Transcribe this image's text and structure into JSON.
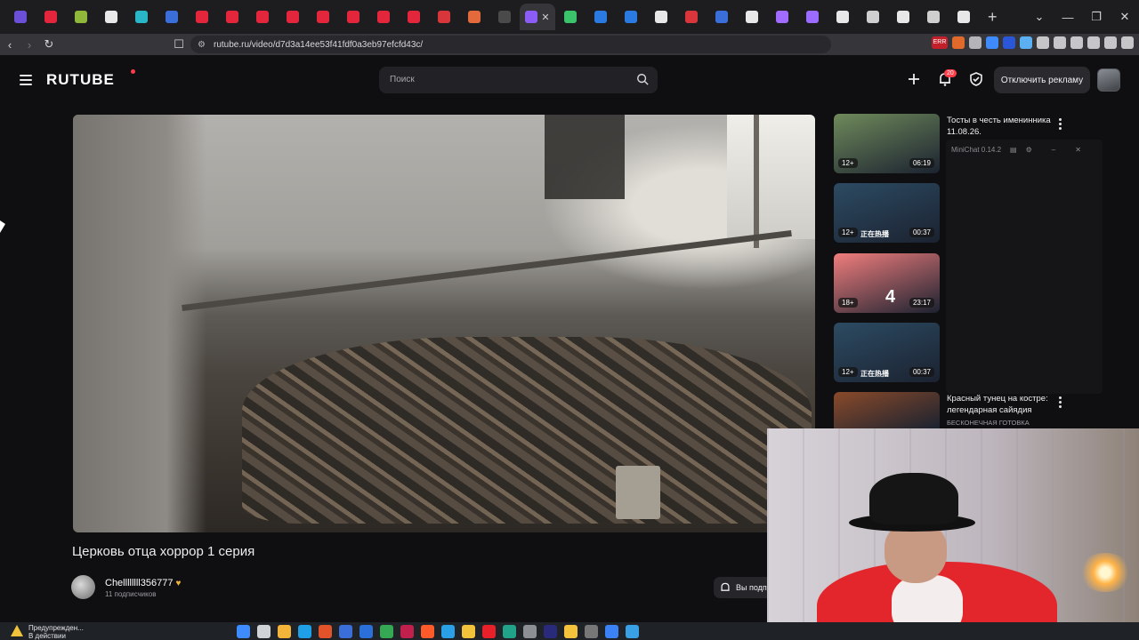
{
  "browser": {
    "tab_count": 34,
    "active_tab_close": "✕",
    "new_tab": "+",
    "window_controls": [
      "⌄",
      "—",
      "❐",
      "✕"
    ],
    "url": "rutube.ru/video/d7d3a14ee53f41fdf0a3eb97efcfd43c/",
    "tab_colors": [
      "#6b4fd8",
      "#e3263b",
      "#8fb83b",
      "#e8e8e8",
      "#29b6c8",
      "#3a6ed8",
      "#e3263b",
      "#e3263b",
      "#e3263b",
      "#e3263b",
      "#e3263b",
      "#e3263b",
      "#e3263b",
      "#e3263b",
      "#d8363b",
      "#e56a3b",
      "#4a4a4a",
      "#8b5cf6",
      "#3ac36a",
      "#2a7ae2",
      "#2a7ae2",
      "#e8e8e8",
      "#d8363b",
      "#3a6ed8",
      "#e8e8e8",
      "#a16bff",
      "#9b6bff",
      "#e8e8e8",
      "#cfcfcf",
      "#e8e8e8",
      "#cfcfcf",
      "#e8e8e8"
    ],
    "ext_badge": "ERR"
  },
  "header": {
    "logo": "RUTUBE",
    "search_placeholder": "Поиск",
    "notifications_count": "20",
    "ads_button": "Отключить рекламу"
  },
  "video": {
    "title": "Церковь отца хоррор 1 серия",
    "channel": "Chellllllll356777",
    "subscribers": "11 подписчиков",
    "subscribe_label": "Вы подп"
  },
  "recommendations": [
    {
      "title": "Тосты в честь именинника 11.08.26.",
      "channel": "",
      "age": "12+",
      "duration": "06:19",
      "color": "#6f8a5b"
    },
    {
      "title": "",
      "channel": "",
      "age": "12+",
      "duration": "00:37",
      "color": "#2c4b62",
      "overlay": "正在热播"
    },
    {
      "title": "",
      "channel": "",
      "age": "18+",
      "duration": "23:17",
      "color": "#f07d7d",
      "overlay": "4"
    },
    {
      "title": "",
      "channel": "",
      "age": "12+",
      "duration": "00:37",
      "color": "#2c4b62",
      "overlay": "正在热播"
    },
    {
      "title": "Красный тунец на костре: легендарная сайядия",
      "channel": "БЕСКОНЕЧНАЯ ГОТОВКА",
      "age": "",
      "duration": "",
      "color": "#8a4a2a"
    }
  ],
  "minichat": {
    "title": "MiniChat 0.14.2"
  },
  "taskbar": {
    "warning_line1": "Предупрежден...",
    "warning_line2": "В действии",
    "icon_colors": [
      "#3d8bfd",
      "#cfd3d8",
      "#f2b53a",
      "#1fa0e6",
      "#e2532a",
      "#3a6ed8",
      "#2b6fd8",
      "#34a853",
      "#c0204b",
      "#ff5a2a",
      "#2aa1e6",
      "#f2c23a",
      "#e8202a",
      "#21a38a",
      "#8c8f93",
      "#2a2a7a",
      "#f5c33b",
      "#777",
      "#3b82f6",
      "#3aa0e6"
    ]
  }
}
